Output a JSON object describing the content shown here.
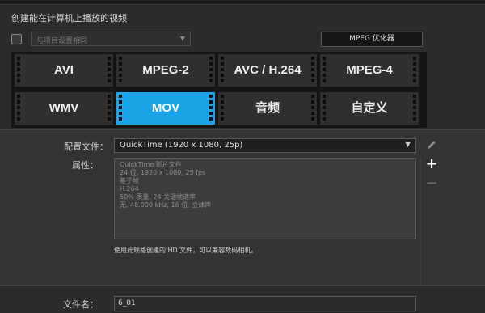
{
  "section_title": "创建能在计算机上播放的视频",
  "project_checkbox": {
    "checked": false
  },
  "project_select": {
    "value": "与项目设置相同"
  },
  "mpeg_optimizer": {
    "label": "MPEG 优化器"
  },
  "formats": [
    {
      "label": "AVI",
      "selected": false
    },
    {
      "label": "MPEG-2",
      "selected": false
    },
    {
      "label": "AVC / H.264",
      "selected": false
    },
    {
      "label": "MPEG-4",
      "selected": false
    },
    {
      "label": "WMV",
      "selected": false
    },
    {
      "label": "MOV",
      "selected": true
    },
    {
      "label": "音频",
      "selected": false
    },
    {
      "label": "自定义",
      "selected": false
    }
  ],
  "profile": {
    "label": "配置文件：",
    "value": "QuickTime (1920 x 1080, 25p)"
  },
  "properties": {
    "label": "属性：",
    "lines": [
      "QuickTime 影片文件",
      "24 位, 1920 x 1080, 25 fps",
      "基于帧",
      "H.264",
      "50% 质量, 24 关键帧速率",
      "无, 48.000 kHz, 16 位, 立体声"
    ]
  },
  "note": "使用此规格创建的 HD 文件，可以兼容数码相机。",
  "filename": {
    "label": "文件名：",
    "value": "6_01"
  },
  "icons": [
    "pencil-icon",
    "plus-icon",
    "minus-icon"
  ],
  "colors": {
    "accent": "#1aa3e6",
    "background": "#2b2b2b",
    "tile": "#2f2f2f"
  }
}
